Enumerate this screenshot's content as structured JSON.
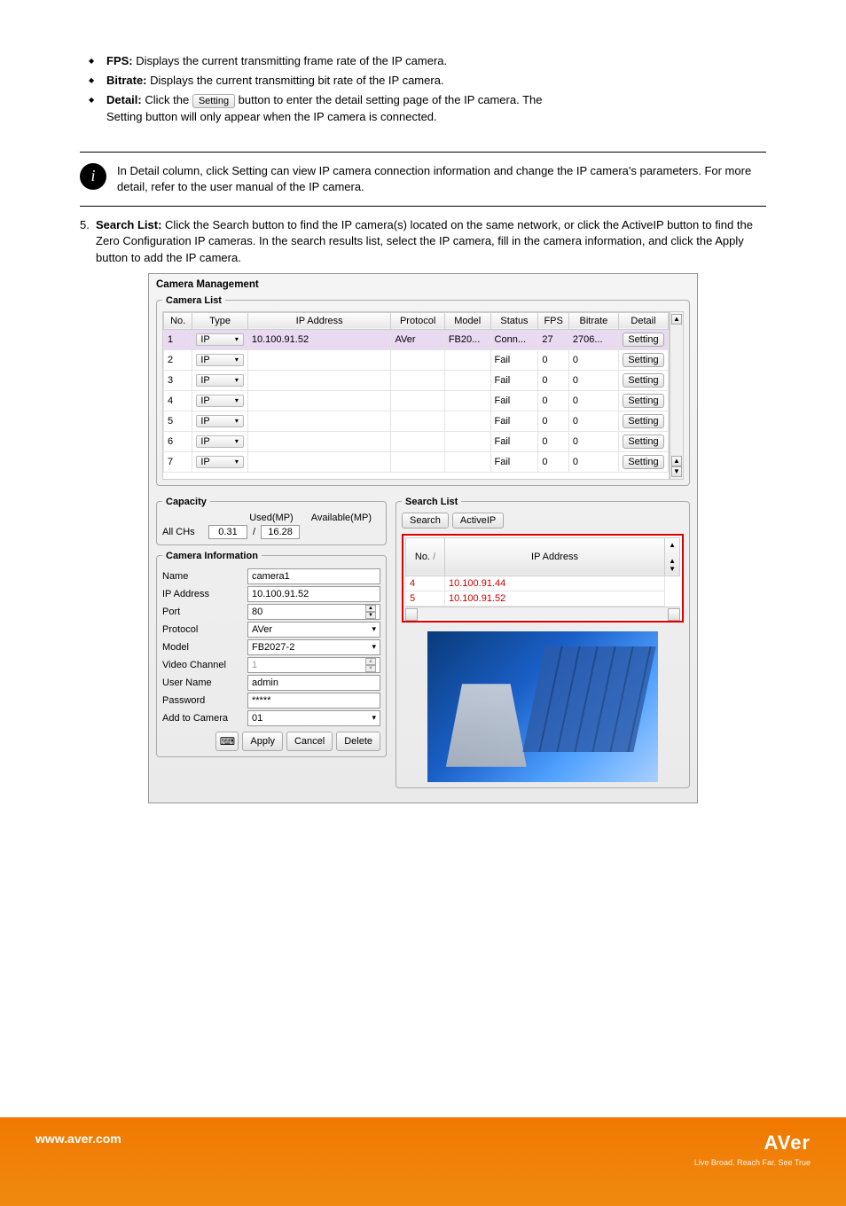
{
  "intro_bullets": [
    {
      "label": "FPS:",
      "text": " Displays the current transmitting frame rate of the IP camera."
    },
    {
      "label": "Bitrate:",
      "text": " Displays the current transmitting bit rate of the IP camera."
    },
    {
      "label": "Detail:",
      "text": " Click the ",
      "btn": "Setting",
      "text2": " button to enter the detail setting page of the IP camera. The"
    }
  ],
  "intro_tail": "Setting button will only appear when the IP camera is connected.",
  "info_note": "In Detail column, click Setting can view IP camera connection information and change the IP camera's parameters. For more detail, refer to the user manual of the IP camera.",
  "step": {
    "num": "5.",
    "text1": "Search List:",
    "text2": " Click the Search button to find the IP camera(s) located on the same network, or click the ActiveIP button to find the Zero Configuration IP cameras. In the search results list, select the IP camera, fill in the camera information, and click the Apply button to add the IP camera."
  },
  "panel": {
    "title": "Camera Management",
    "cam_list": {
      "legend": "Camera List",
      "headers": [
        "No.",
        "Type",
        "IP Address",
        "Protocol",
        "Model",
        "Status",
        "FPS",
        "Bitrate",
        "Detail"
      ],
      "rows": [
        {
          "no": "1",
          "type": "IP",
          "ip": "10.100.91.52",
          "protocol": "AVer",
          "model": "FB20...",
          "status": "Conn...",
          "fps": "27",
          "bitrate": "2706...",
          "detail": "Setting",
          "selected": true
        },
        {
          "no": "2",
          "type": "IP",
          "ip": "",
          "protocol": "",
          "model": "",
          "status": "Fail",
          "fps": "0",
          "bitrate": "0",
          "detail": "Setting"
        },
        {
          "no": "3",
          "type": "IP",
          "ip": "",
          "protocol": "",
          "model": "",
          "status": "Fail",
          "fps": "0",
          "bitrate": "0",
          "detail": "Setting"
        },
        {
          "no": "4",
          "type": "IP",
          "ip": "",
          "protocol": "",
          "model": "",
          "status": "Fail",
          "fps": "0",
          "bitrate": "0",
          "detail": "Setting"
        },
        {
          "no": "5",
          "type": "IP",
          "ip": "",
          "protocol": "",
          "model": "",
          "status": "Fail",
          "fps": "0",
          "bitrate": "0",
          "detail": "Setting"
        },
        {
          "no": "6",
          "type": "IP",
          "ip": "",
          "protocol": "",
          "model": "",
          "status": "Fail",
          "fps": "0",
          "bitrate": "0",
          "detail": "Setting"
        },
        {
          "no": "7",
          "type": "IP",
          "ip": "",
          "protocol": "",
          "model": "",
          "status": "Fail",
          "fps": "0",
          "bitrate": "0",
          "detail": "Setting"
        }
      ]
    },
    "capacity": {
      "legend": "Capacity",
      "allchs": "All CHs",
      "used_label": "Used(MP)",
      "avail_label": "Available(MP)",
      "used": "0.31",
      "slash": "/",
      "avail": "16.28"
    },
    "caminfo": {
      "legend": "Camera Information",
      "fields": {
        "name": {
          "label": "Name",
          "value": "camera1"
        },
        "ip": {
          "label": "IP Address",
          "value": "10.100.91.52"
        },
        "port": {
          "label": "Port",
          "value": "80"
        },
        "protocol": {
          "label": "Protocol",
          "value": "AVer"
        },
        "model": {
          "label": "Model",
          "value": "FB2027-2"
        },
        "video_channel": {
          "label": "Video Channel",
          "value": "1"
        },
        "user": {
          "label": "User Name",
          "value": "admin"
        },
        "password": {
          "label": "Password",
          "value": "*****"
        },
        "add": {
          "label": "Add to Camera",
          "value": "01"
        }
      },
      "buttons": {
        "apply": "Apply",
        "cancel": "Cancel",
        "delete": "Delete"
      }
    },
    "searchlist": {
      "legend": "Search List",
      "search_btn": "Search",
      "activeip_btn": "ActiveIP",
      "headers": {
        "no": "No.",
        "sort": "/",
        "ip": "IP Address"
      },
      "rows": [
        {
          "no": "4",
          "ip": "10.100.91.44"
        },
        {
          "no": "5",
          "ip": "10.100.91.52"
        }
      ]
    }
  },
  "footer": {
    "site": "www.aver.com",
    "brand": "AVer",
    "slogan": "Live Broad. Reach Far. See True"
  }
}
